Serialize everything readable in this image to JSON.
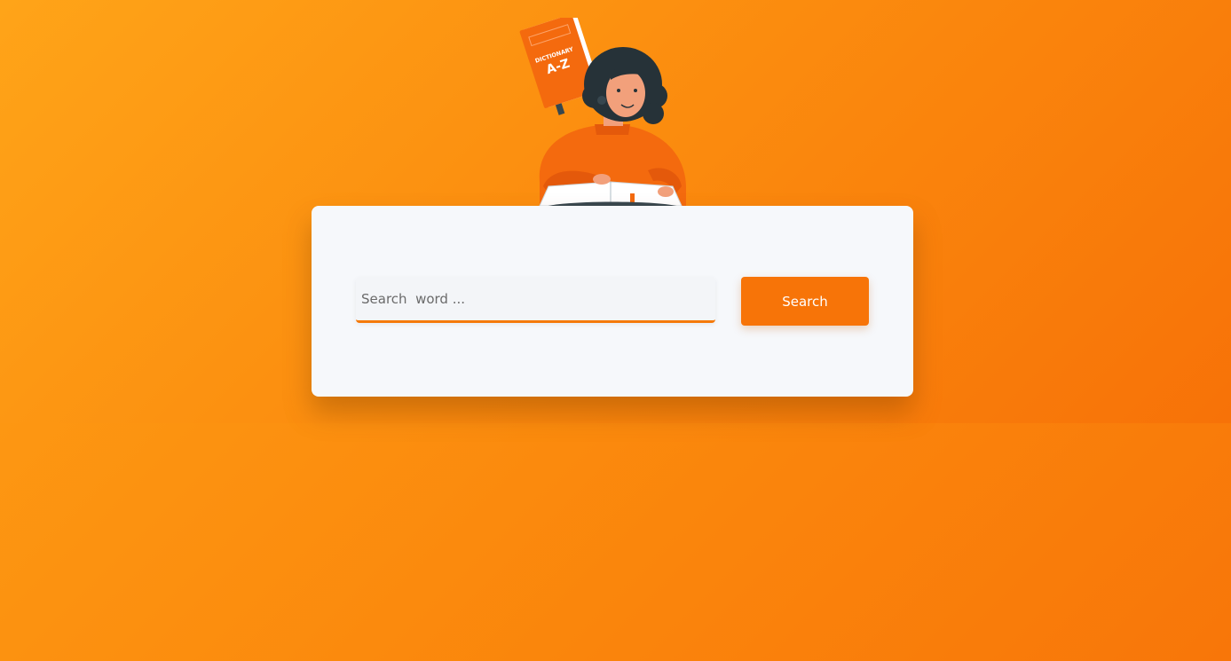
{
  "illustration": {
    "book_label_small": "DICTIONARY",
    "book_label_large": "A-Z"
  },
  "search": {
    "placeholder": "Search  word ...",
    "value": "",
    "button_label": "Search"
  },
  "colors": {
    "accent": "#f77408",
    "card_background": "#f6f8fb",
    "gradient_start": "#ffa315",
    "gradient_end": "#f77208"
  }
}
